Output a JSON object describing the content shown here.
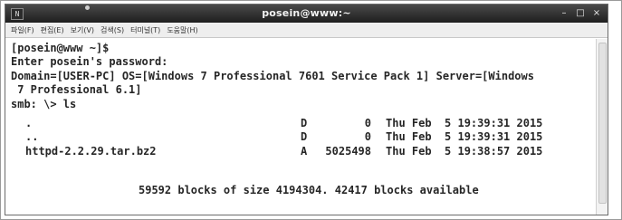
{
  "window": {
    "title": "posein@www:~",
    "icon_glyph": "N",
    "controls": [
      "–",
      "□",
      "×"
    ]
  },
  "menubar": {
    "items": [
      "파일(F)",
      "편집(E)",
      "보기(V)",
      "검색(S)",
      "터미널(T)",
      "도움말(H)"
    ]
  },
  "terminal": {
    "prompt": "[posein@www ~]$",
    "password_prompt": "Enter posein's password:",
    "domain_line_1": "Domain=[USER-PC] OS=[Windows 7 Professional 7601 Service Pack 1] Server=[Windows",
    "domain_line_2": " 7 Professional 6.1]",
    "smb_command": "smb: \\> ls",
    "listing": [
      {
        "name": ".",
        "attr": "D",
        "size": "0",
        "date": "Thu Feb  5 19:39:31 2015"
      },
      {
        "name": "..",
        "attr": "D",
        "size": "0",
        "date": "Thu Feb  5 19:39:31 2015"
      },
      {
        "name": "httpd-2.2.29.tar.bz2",
        "attr": "A",
        "size": "5025498",
        "date": "Thu Feb  5 19:38:57 2015"
      }
    ],
    "summary": "59592 blocks of size 4194304. 42417 blocks available"
  },
  "icons": {
    "app": "terminal-icon",
    "minimize": "minimize-icon",
    "maximize": "maximize-icon",
    "close": "close-icon"
  }
}
